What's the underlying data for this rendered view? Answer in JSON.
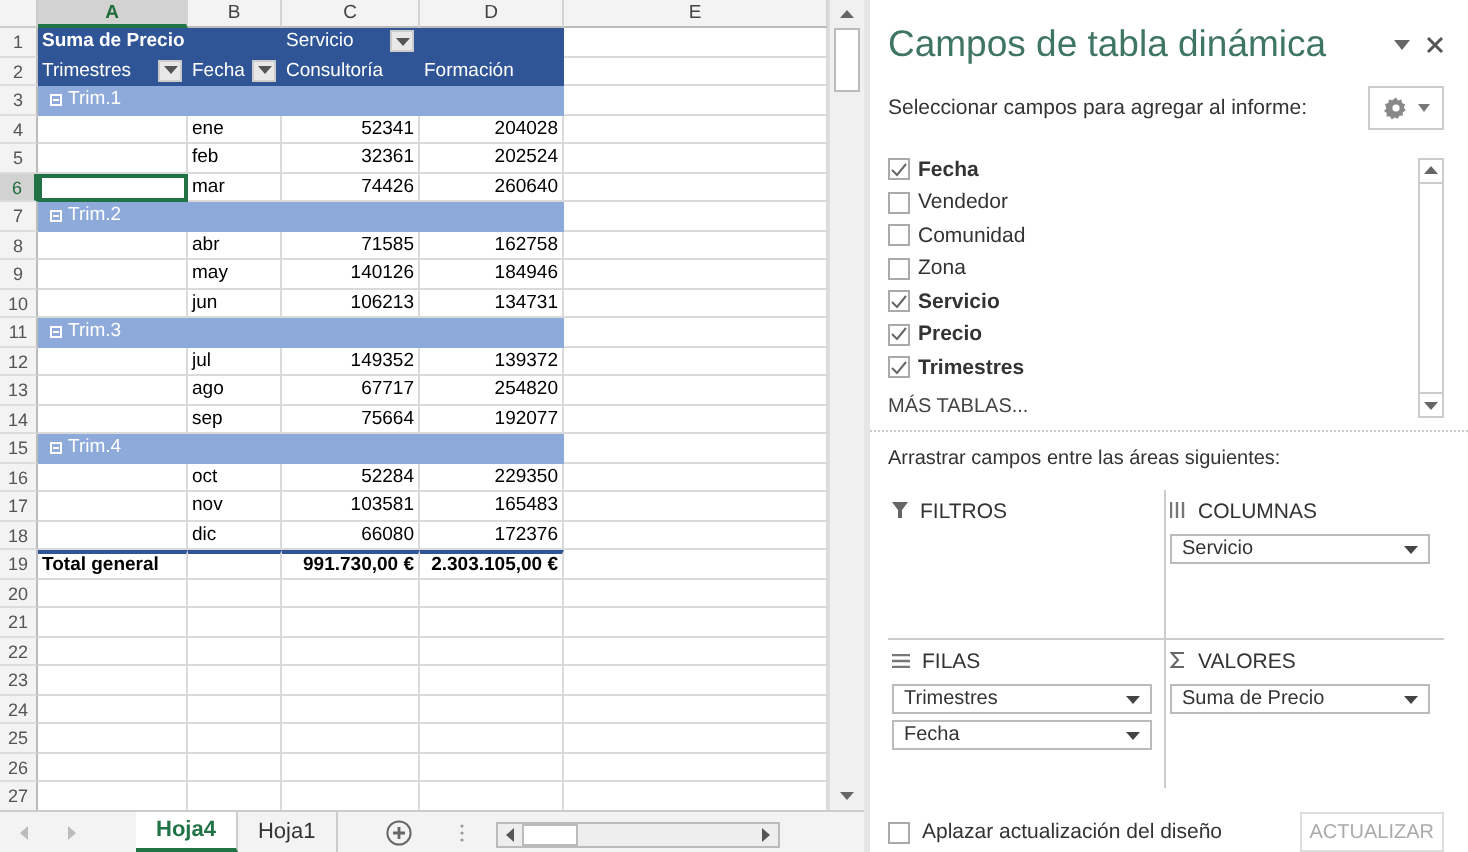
{
  "sheet": {
    "columns": [
      {
        "label": "A",
        "selected": true
      },
      {
        "label": "B",
        "selected": false
      },
      {
        "label": "C",
        "selected": false
      },
      {
        "label": "D",
        "selected": false
      },
      {
        "label": "E",
        "selected": false
      }
    ],
    "rows": [
      {
        "number": "1",
        "kind": "pivot-title",
        "selected": false,
        "value_label": "Suma de Precio",
        "column_field": "Servicio"
      },
      {
        "number": "2",
        "kind": "pivot-header",
        "selected": false,
        "row_field": "Trimestres",
        "sub_field": "Fecha",
        "columns": [
          "Consultoría",
          "Formación"
        ]
      },
      {
        "number": "3",
        "kind": "group",
        "selected": false,
        "label": "Trim.1"
      },
      {
        "number": "4",
        "kind": "item",
        "selected": false,
        "label": "ene",
        "values": [
          "52341",
          "204028"
        ]
      },
      {
        "number": "5",
        "kind": "item",
        "selected": false,
        "label": "feb",
        "values": [
          "32361",
          "202524"
        ]
      },
      {
        "number": "6",
        "kind": "item",
        "selected": true,
        "label": "mar",
        "values": [
          "74426",
          "260640"
        ]
      },
      {
        "number": "7",
        "kind": "group",
        "selected": false,
        "label": "Trim.2"
      },
      {
        "number": "8",
        "kind": "item",
        "selected": false,
        "label": "abr",
        "values": [
          "71585",
          "162758"
        ]
      },
      {
        "number": "9",
        "kind": "item",
        "selected": false,
        "label": "may",
        "values": [
          "140126",
          "184946"
        ]
      },
      {
        "number": "10",
        "kind": "item",
        "selected": false,
        "label": "jun",
        "values": [
          "106213",
          "134731"
        ]
      },
      {
        "number": "11",
        "kind": "group",
        "selected": false,
        "label": "Trim.3"
      },
      {
        "number": "12",
        "kind": "item",
        "selected": false,
        "label": "jul",
        "values": [
          "149352",
          "139372"
        ]
      },
      {
        "number": "13",
        "kind": "item",
        "selected": false,
        "label": "ago",
        "values": [
          "67717",
          "254820"
        ]
      },
      {
        "number": "14",
        "kind": "item",
        "selected": false,
        "label": "sep",
        "values": [
          "75664",
          "192077"
        ]
      },
      {
        "number": "15",
        "kind": "group",
        "selected": false,
        "label": "Trim.4"
      },
      {
        "number": "16",
        "kind": "item",
        "selected": false,
        "label": "oct",
        "values": [
          "52284",
          "229350"
        ]
      },
      {
        "number": "17",
        "kind": "item",
        "selected": false,
        "label": "nov",
        "values": [
          "103581",
          "165483"
        ]
      },
      {
        "number": "18",
        "kind": "item",
        "selected": false,
        "label": "dic",
        "values": [
          "66080",
          "172376"
        ]
      },
      {
        "number": "19",
        "kind": "total",
        "selected": false,
        "label": "Total general",
        "values": [
          "991.730,00 €",
          "2.303.105,00 €"
        ]
      },
      {
        "number": "20",
        "kind": "empty",
        "selected": false
      },
      {
        "number": "21",
        "kind": "empty",
        "selected": false
      },
      {
        "number": "22",
        "kind": "empty",
        "selected": false
      },
      {
        "number": "23",
        "kind": "empty",
        "selected": false
      },
      {
        "number": "24",
        "kind": "empty",
        "selected": false
      },
      {
        "number": "25",
        "kind": "empty",
        "selected": false
      },
      {
        "number": "26",
        "kind": "empty",
        "selected": false
      },
      {
        "number": "27",
        "kind": "empty",
        "selected": false
      }
    ]
  },
  "sheet_tabs": [
    {
      "label": "Hoja4",
      "selected": true
    },
    {
      "label": "Hoja1",
      "selected": false
    }
  ],
  "panel": {
    "title": "Campos de tabla dinámica",
    "subtitle": "Seleccionar campos para agregar al informe:",
    "fields": [
      {
        "label": "Fecha",
        "checked": true
      },
      {
        "label": "Vendedor",
        "checked": false
      },
      {
        "label": "Comunidad",
        "checked": false
      },
      {
        "label": "Zona",
        "checked": false
      },
      {
        "label": "Servicio",
        "checked": true
      },
      {
        "label": "Precio",
        "checked": true
      },
      {
        "label": "Trimestres",
        "checked": true
      }
    ],
    "more_tables": "MÁS TABLAS...",
    "areas_hint": "Arrastrar campos entre las áreas siguientes:",
    "areas": [
      {
        "kind": "filters",
        "title": "FILTROS"
      },
      {
        "kind": "columns",
        "title": "COLUMNAS",
        "items": [
          "Servicio"
        ]
      },
      {
        "kind": "rows",
        "title": "FILAS",
        "items": [
          "Trimestres",
          "Fecha"
        ]
      },
      {
        "kind": "values",
        "title": "VALORES",
        "items": [
          "Suma de Precio"
        ]
      }
    ],
    "defer": {
      "label": "Aplazar actualización del diseño",
      "checked": false
    },
    "update_button": {
      "label": "ACTUALIZAR",
      "disabled": true
    }
  }
}
